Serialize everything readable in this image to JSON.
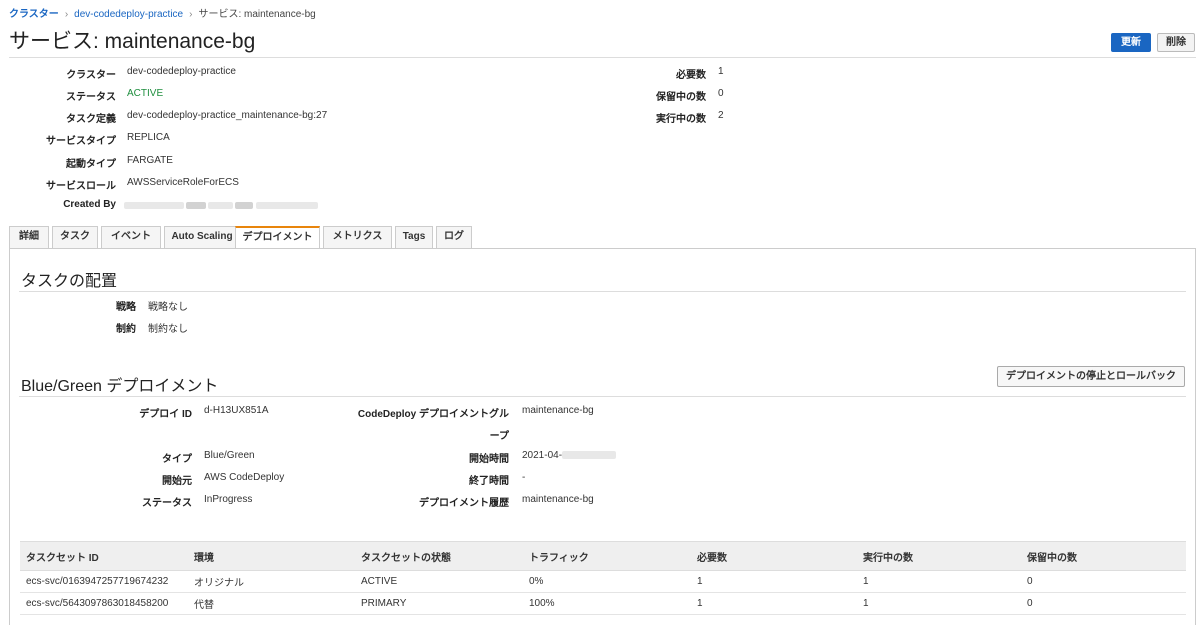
{
  "breadcrumb": {
    "root": "クラスター",
    "cluster": "dev-codedeploy-practice",
    "current": "サービス: maintenance-bg"
  },
  "page_title": "サービス: maintenance-bg",
  "header_buttons": {
    "update": "更新",
    "delete": "削除"
  },
  "service_details": {
    "cluster_label": "クラスター",
    "cluster_value": "dev-codedeploy-practice",
    "status_label": "ステータス",
    "status_value": "ACTIVE",
    "taskdef_label": "タスク定義",
    "taskdef_value": "dev-codedeploy-practice_maintenance-bg:27",
    "service_type_label": "サービスタイプ",
    "service_type_value": "REPLICA",
    "launch_type_label": "起動タイプ",
    "launch_type_value": "FARGATE",
    "service_role_label": "サービスロール",
    "service_role_value": "AWSServiceRoleForECS",
    "created_by_label": "Created By"
  },
  "counts": {
    "desired_label": "必要数",
    "desired_value": "1",
    "pending_label": "保留中の数",
    "pending_value": "0",
    "running_label": "実行中の数",
    "running_value": "2"
  },
  "tabs": [
    "詳細",
    "タスク",
    "イベント",
    "Auto Scaling",
    "デプロイメント",
    "メトリクス",
    "Tags",
    "ログ"
  ],
  "active_tab": "デプロイメント",
  "placement": {
    "title": "タスクの配置",
    "strategy_label": "戦略",
    "strategy_value": "戦略なし",
    "constraint_label": "制約",
    "constraint_value": "制約なし"
  },
  "bluegreen": {
    "title": "Blue/Green デプロイメント",
    "stop_button": "デプロイメントの停止とロールバック",
    "deploy_id_label": "デプロイ ID",
    "deploy_id_value": "d-H13UX851A",
    "type_label": "タイプ",
    "type_value": "Blue/Green",
    "initiator_label": "開始元",
    "initiator_value": "AWS CodeDeploy",
    "status_label": "ステータス",
    "status_value": "InProgress",
    "group_label_line1": "CodeDeploy デプロイメントグル",
    "group_label_line2": "ープ",
    "group_value": "maintenance-bg",
    "start_label": "開始時間",
    "start_value": "2021-04-",
    "end_label": "終了時間",
    "end_value": "-",
    "history_label": "デプロイメント履歴",
    "history_value": "maintenance-bg"
  },
  "taskset_table": {
    "headers": [
      "タスクセット ID",
      "環境",
      "タスクセットの状態",
      "トラフィック",
      "必要数",
      "実行中の数",
      "保留中の数"
    ],
    "rows": [
      [
        "ecs-svc/0163947257719674232",
        "オリジナル",
        "ACTIVE",
        "0%",
        "1",
        "1",
        "0"
      ],
      [
        "ecs-svc/5643097863018458200",
        "代替",
        "PRIMARY",
        "100%",
        "1",
        "1",
        "0"
      ]
    ]
  },
  "colors": {
    "link": "#1a66c2",
    "primary_button": "#1a66c2",
    "active_status": "#1e8e3e",
    "active_tab_accent": "#e8850c"
  }
}
